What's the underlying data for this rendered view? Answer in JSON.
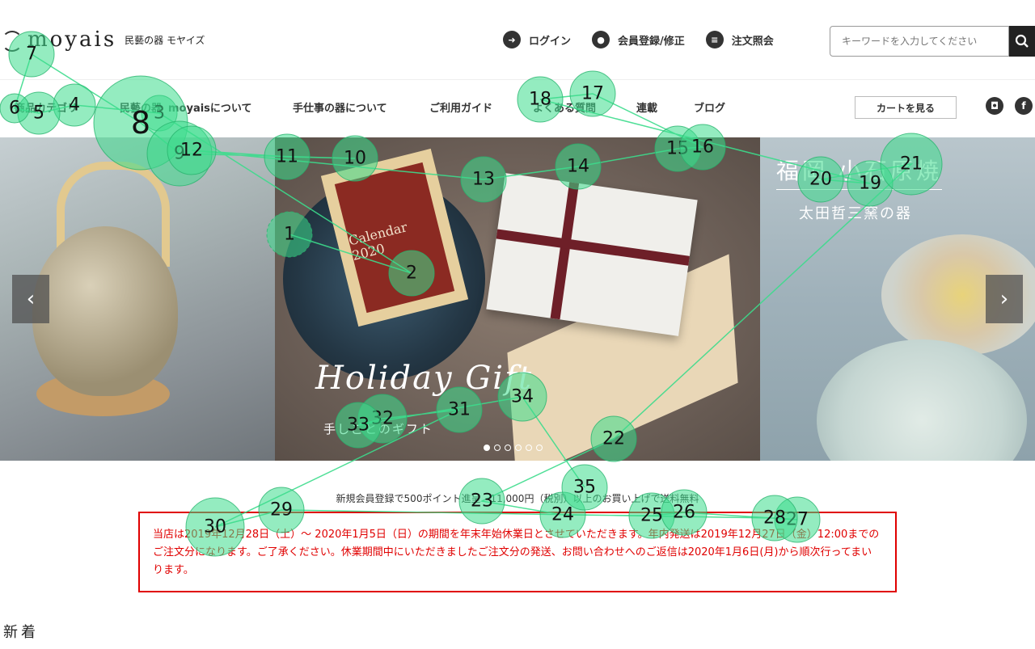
{
  "logo": {
    "text": "moyais",
    "sub": "民藝の器 モヤイズ"
  },
  "header": {
    "links": [
      {
        "label": "ログイン",
        "icon": "login-icon",
        "glyph": "➜"
      },
      {
        "label": "会員登録/修正",
        "icon": "user-icon",
        "glyph": "●"
      },
      {
        "label": "注文照会",
        "icon": "list-icon",
        "glyph": "≡"
      }
    ],
    "search_placeholder": "キーワードを入力してください",
    "search_icon": "search-icon"
  },
  "nav": {
    "items": [
      "商品カテゴリ",
      "民藝の器",
      "moyaisについて",
      "手仕事の器について",
      "ご利用ガイド",
      "よくある質問",
      "連載",
      "ブログ"
    ],
    "cart": "カートを見る",
    "social": [
      {
        "icon": "instagram-icon",
        "glyph": "◘"
      },
      {
        "icon": "facebook-icon",
        "glyph": "f"
      }
    ]
  },
  "hero": {
    "center_script": "Holiday Gift",
    "center_sub": "手しごとのギフト",
    "frame_text": "Calendar 2020",
    "right_title": "福岡 小石原焼",
    "right_sub": "太田哲三窯の器",
    "prev": "‹",
    "next": "›",
    "dots": 6,
    "active_dot": 0
  },
  "promo": "新規会員登録で500ポイント進呈　11,000円（税別）以上のお買い上げで送料無料",
  "notice": "当店は2019年12月28日（土）～ 2020年1月5日（日）の期間を年末年始休業日とさせていただきます。年内発送は2019年12月27日（金）12:00までのご注文分になります。ご了承ください。休業期間中にいただきましたご注文分の発送、お問い合わせへのご返信は2020年1月6日(月)から順次行ってまいります。",
  "section_title": "新着",
  "overlay_colors": {
    "fill": "#3cdc8c",
    "line": "#3cdc8c"
  },
  "gaze": [
    {
      "n": "1"
    },
    {
      "n": "2"
    },
    {
      "n": "3"
    },
    {
      "n": "4"
    },
    {
      "n": "5"
    },
    {
      "n": "6"
    },
    {
      "n": "7"
    },
    {
      "n": "8"
    },
    {
      "n": "9"
    },
    {
      "n": "10"
    },
    {
      "n": "11"
    },
    {
      "n": "12"
    },
    {
      "n": "13"
    },
    {
      "n": "14"
    },
    {
      "n": "15"
    },
    {
      "n": "16"
    },
    {
      "n": "17"
    },
    {
      "n": "18"
    },
    {
      "n": "19"
    },
    {
      "n": "20"
    },
    {
      "n": "21"
    },
    {
      "n": "22"
    },
    {
      "n": "23"
    },
    {
      "n": "24"
    },
    {
      "n": "25"
    },
    {
      "n": "26"
    },
    {
      "n": "27"
    },
    {
      "n": "28"
    },
    {
      "n": "29"
    },
    {
      "n": "30"
    },
    {
      "n": "31"
    },
    {
      "n": "32"
    },
    {
      "n": "33"
    },
    {
      "n": "34"
    },
    {
      "n": "35"
    }
  ]
}
